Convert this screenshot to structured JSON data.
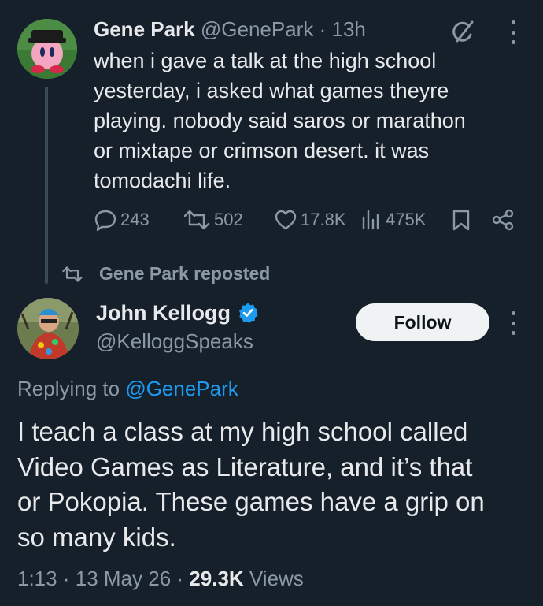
{
  "parent_tweet": {
    "author_name": "Gene Park",
    "handle": "@GenePark",
    "separator": "·",
    "age": "13h",
    "text": "when i gave a talk at the high school\nyesterday, i asked what games theyre\nplaying. nobody said saros or marathon\nor mixtape or crimson desert. it was\ntomodachi life.",
    "replies": "243",
    "reposts": "502",
    "likes": "17.8K",
    "views": "475K",
    "icons": [
      "grok-icon",
      "more-icon",
      "reply-icon",
      "repost-icon",
      "like-icon",
      "views-icon",
      "bookmark-icon",
      "share-icon"
    ]
  },
  "repost_banner": {
    "label": "Gene Park reposted"
  },
  "main_tweet": {
    "author_name": "John Kellogg",
    "verified": true,
    "handle": "@KelloggSpeaks",
    "follow_label": "Follow",
    "replying_prefix": "Replying to ",
    "replying_to": "@GenePark",
    "text": "I teach a class at my high school called\nVideo Games as Literature, and it’s that\nor Pokopia. These games have a grip on\nso many kids.",
    "time": "1:13",
    "separator": "·",
    "date": "13 May 26",
    "views_count": "29.3K",
    "views_label": "Views"
  },
  "colors": {
    "background": "#15202b",
    "primary_text": "#e7e9ea",
    "secondary_text": "#8b98a5",
    "link": "#1d9bf0",
    "verified_badge": "#1d9bf0",
    "follow_button_bg": "#eff3f4"
  }
}
